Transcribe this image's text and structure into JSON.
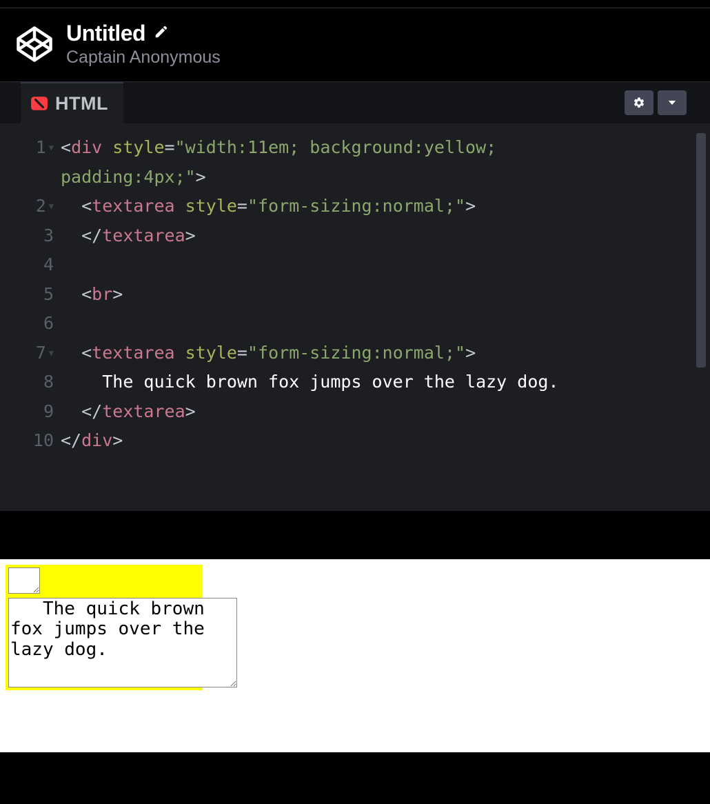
{
  "header": {
    "title": "Untitled",
    "author": "Captain Anonymous"
  },
  "editor": {
    "tab_label": "HTML",
    "lines": {
      "l1a": "<",
      "l1b": "div",
      "l1c": " ",
      "l1d": "style",
      "l1e": "=",
      "l1f": "\"width:11em; background:yellow; ",
      "l1g": "padding:4px;\"",
      "l1h": ">",
      "l2a": "<",
      "l2b": "textarea",
      "l2c": " ",
      "l2d": "style",
      "l2e": "=",
      "l2f": "\"form-sizing:normal;\"",
      "l2g": ">",
      "l3a": "</",
      "l3b": "textarea",
      "l3c": ">",
      "l5a": "<",
      "l5b": "br",
      "l5c": ">",
      "l7a": "<",
      "l7b": "textarea",
      "l7c": " ",
      "l7d": "style",
      "l7e": "=",
      "l7f": "\"form-sizing:normal;\"",
      "l7g": ">",
      "l8": "The quick brown fox jumps over the lazy dog.",
      "l9a": "</",
      "l9b": "textarea",
      "l9c": ">",
      "l10a": "</",
      "l10b": "div",
      "l10c": ">"
    },
    "line_numbers": [
      "1",
      "2",
      "3",
      "4",
      "5",
      "6",
      "7",
      "8",
      "9",
      "10"
    ]
  },
  "preview": {
    "textarea1_value": "",
    "textarea2_value": "   The quick brown fox jumps over the lazy dog."
  }
}
